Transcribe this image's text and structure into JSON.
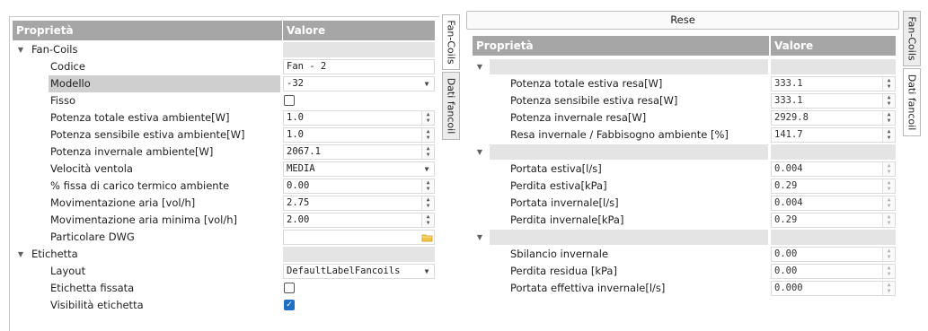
{
  "left": {
    "header": {
      "prop": "Proprietà",
      "val": "Valore"
    },
    "tabs": [
      {
        "label": "Fan-Coils"
      },
      {
        "label": "Dati fancoil"
      }
    ],
    "categories": [
      {
        "name": "Fan-Coils",
        "rows": [
          {
            "label": "Codice",
            "value": "Fan - 2"
          },
          {
            "label": "Modello",
            "value": "-32"
          },
          {
            "label": "Fisso",
            "value": ""
          },
          {
            "label": "Potenza totale estiva ambiente[W]",
            "value": "1.0"
          },
          {
            "label": "Potenza sensibile estiva ambiente[W]",
            "value": "1.0"
          },
          {
            "label": "Potenza invernale ambiente[W]",
            "value": "2067.1"
          },
          {
            "label": "Velocità ventola",
            "value": "MEDIA"
          },
          {
            "label": "% fissa di carico termico ambiente",
            "value": "0.00"
          },
          {
            "label": "Movimentazione aria [vol/h]",
            "value": "2.75"
          },
          {
            "label": "Movimentazione aria minima [vol/h]",
            "value": "2.00"
          },
          {
            "label": "Particolare DWG",
            "value": ""
          }
        ]
      },
      {
        "name": "Etichetta",
        "rows": [
          {
            "label": "Layout",
            "value": "DefaultLabelFancoils"
          },
          {
            "label": "Etichetta fissata",
            "value": ""
          },
          {
            "label": "Visibilità etichetta",
            "value": ""
          }
        ]
      }
    ]
  },
  "right": {
    "title": "Rese",
    "header": {
      "prop": "Proprietà",
      "val": "Valore"
    },
    "tabs": [
      {
        "label": "Fan-Coils"
      },
      {
        "label": "Dati fancoil"
      }
    ],
    "groups": [
      {
        "rows": [
          {
            "label": "Potenza totale estiva resa[W]",
            "value": "333.1"
          },
          {
            "label": "Potenza sensibile estiva resa[W]",
            "value": "333.1"
          },
          {
            "label": "Potenza invernale resa[W]",
            "value": "2929.8"
          },
          {
            "label": "Resa invernale / Fabbisogno ambiente [%]",
            "value": "141.7"
          }
        ]
      },
      {
        "rows": [
          {
            "label": "Portata estiva[l/s]",
            "value": "0.004"
          },
          {
            "label": "Perdita estiva[kPa]",
            "value": "0.29"
          },
          {
            "label": "Portata invernale[l/s]",
            "value": "0.004"
          },
          {
            "label": "Perdita invernale[kPa]",
            "value": "0.29"
          }
        ]
      },
      {
        "rows": [
          {
            "label": "Sbilancio invernale",
            "value": "0.00"
          },
          {
            "label": "Perdita residua [kPa]",
            "value": "0.00"
          },
          {
            "label": "Portata effettiva invernale[l/s]",
            "value": "0.000"
          }
        ]
      }
    ]
  }
}
